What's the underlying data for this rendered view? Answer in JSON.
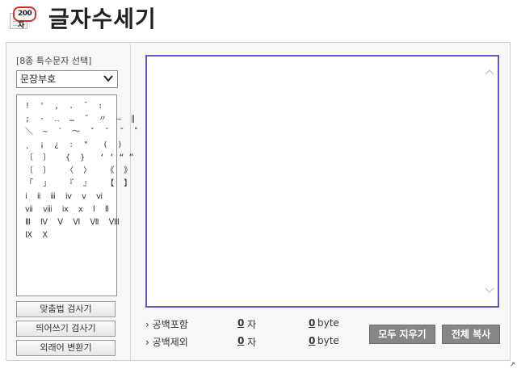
{
  "header": {
    "logo_badge": "200자",
    "title": "글자수세기"
  },
  "sidebar": {
    "caption": "[8종 특수문자 선택]",
    "select_value": "문장부호",
    "char_lines": [
      "!  '  ,  .  ¯  :",
      ";  ·  ‥  …  ˝  〃  ―  ∥",
      "＼  ∼  ´  ～  ˇ  ˘  ˝  ˚  ˙  ¸",
      "˛  ¡  ¿  ː  \"   (  )",
      "〔  〕   {  }   ‘ ’ “ ”",
      "〔  〕   〈  〉   《  》",
      "「  」   『  』   【  】",
      "ⅰ  ⅱ  ⅲ  ⅳ  ⅴ  ⅵ",
      "ⅶ  ⅷ  ⅸ  ⅹ  Ⅰ  Ⅱ",
      "Ⅲ  Ⅳ  Ⅴ  Ⅵ  Ⅶ  Ⅷ",
      "Ⅸ  Ⅹ"
    ],
    "buttons": [
      "맞춤법 검사기",
      "띄어쓰기 검사기",
      "외래어 변환기"
    ]
  },
  "stats": {
    "with_space": {
      "label": "› 공백포함",
      "chars": "0",
      "chars_unit": "자",
      "bytes": "0",
      "bytes_unit": "byte"
    },
    "without_space": {
      "label": "› 공백제외",
      "chars": "0",
      "chars_unit": "자",
      "bytes": "0",
      "bytes_unit": "byte"
    }
  },
  "actions": {
    "clear_label": "모두 지우기",
    "copy_label": "전체 복사"
  },
  "corner_mark": "↗",
  "colors": {
    "textarea_border": "#6a55c4",
    "action_button": "#868686",
    "logo_bubble_border": "#d0312d"
  }
}
